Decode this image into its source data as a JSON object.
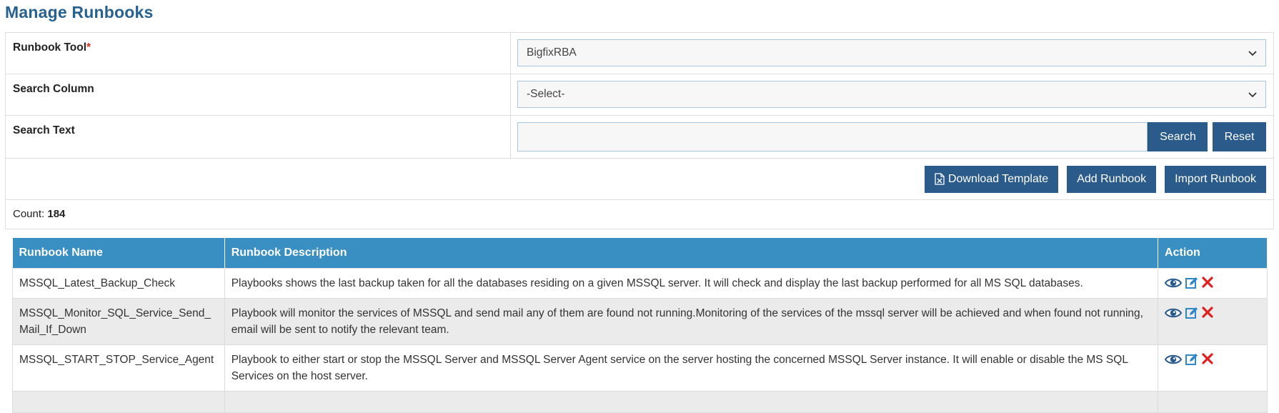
{
  "page": {
    "title": "Manage Runbooks"
  },
  "form": {
    "runbook_tool": {
      "label": "Runbook Tool",
      "required_mark": "*",
      "value": "BigfixRBA",
      "icon": "chevron-down-icon"
    },
    "search_column": {
      "label": "Search Column",
      "value": "-Select-",
      "icon": "chevron-down-icon"
    },
    "search_text": {
      "label": "Search Text",
      "value": "",
      "placeholder": ""
    }
  },
  "buttons": {
    "search": "Search",
    "reset": "Reset",
    "download_template": "Download Template",
    "add_runbook": "Add Runbook",
    "import_runbook": "Import Runbook"
  },
  "count": {
    "label": "Count:",
    "value": "184"
  },
  "table": {
    "columns": [
      "Runbook Name",
      "Runbook Description",
      "Action"
    ],
    "rows": [
      {
        "name": "MSSQL_Latest_Backup_Check",
        "description": "Playbooks shows the last backup taken for all the databases residing on a given MSSQL server. It will check and display the last backup performed for all MS SQL databases."
      },
      {
        "name": "MSSQL_Monitor_SQL_Service_Send_Mail_If_Down",
        "description": "Playbook will monitor the services of MSSQL and send mail any of them are found not running.Monitoring of the services of the mssql server will be achieved and when found not running, email will be sent to notify the relevant team."
      },
      {
        "name": "MSSQL_START_STOP_Service_Agent",
        "description": "Playbook to either start or stop the MSSQL Server and MSSQL Server Agent service on the server hosting the concerned MSSQL Server instance. It will enable or disable the MS SQL Services on the host server."
      }
    ],
    "action_icons": [
      "view-icon",
      "edit-icon",
      "delete-icon"
    ]
  },
  "colors": {
    "title": "#27618f",
    "button": "#2b5b8a",
    "table_header": "#3a8fc2",
    "delete": "#e02020",
    "view": "#2b5b8a",
    "edit": "#2f87c8"
  }
}
